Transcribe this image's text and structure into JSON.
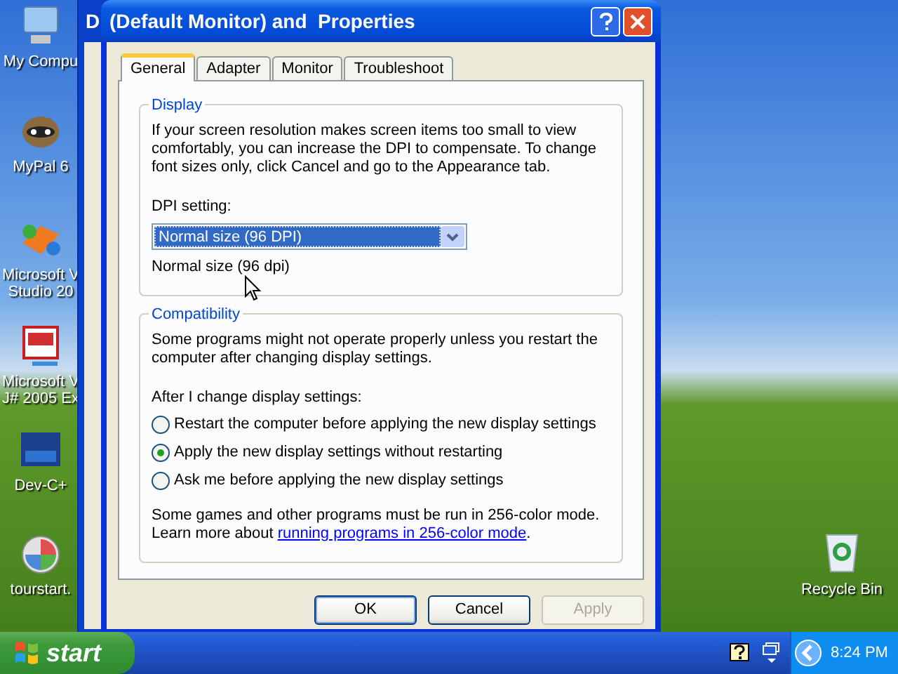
{
  "desktop_icons": [
    {
      "kind": "computer",
      "lines": [
        "My Compu"
      ]
    },
    {
      "kind": "raccoon",
      "lines": [
        "MyPal 6"
      ]
    },
    {
      "kind": "studio",
      "lines": [
        "Microsoft V",
        "Studio 20"
      ]
    },
    {
      "kind": "vj",
      "lines": [
        "Microsoft V",
        "J# 2005 Ex"
      ]
    },
    {
      "kind": "dev",
      "lines": [
        "Dev-C+"
      ]
    },
    {
      "kind": "tour",
      "lines": [
        "tourstart."
      ]
    }
  ],
  "recycle_bin": {
    "label": "Recycle Bin"
  },
  "back_window": {
    "title": "D"
  },
  "dialog": {
    "title": "(Default Monitor) and  Properties",
    "tabs": [
      {
        "label": "General",
        "selected": true
      },
      {
        "label": "Adapter",
        "selected": false
      },
      {
        "label": "Monitor",
        "selected": false
      },
      {
        "label": "Troubleshoot",
        "selected": false
      }
    ],
    "display": {
      "legend": "Display",
      "text": "If your screen resolution makes screen items too small to view comfortably, you can increase the DPI to compensate.  To change font sizes only, click Cancel and go to the Appearance tab.",
      "dpi_label": "DPI setting:",
      "dpi_value": "Normal size (96 DPI)",
      "dpi_caption": "Normal size (96 dpi)"
    },
    "compatibility": {
      "legend": "Compatibility",
      "text": "Some programs might not operate properly unless you restart the computer after changing display settings.",
      "prompt": "After I change display settings:",
      "options": [
        {
          "label": "Restart the computer before applying the new display settings",
          "selected": false
        },
        {
          "label": "Apply the new display settings without restarting",
          "selected": true
        },
        {
          "label": "Ask me before applying the new display settings",
          "selected": false
        }
      ],
      "note": "Some games and other programs must be run in 256-color mode.",
      "learn_prefix": "Learn more about",
      "link": "running programs in 256-color mode",
      "learn_suffix": "."
    },
    "buttons": [
      {
        "label": "OK",
        "disabled": false,
        "default": true
      },
      {
        "label": "Cancel",
        "disabled": false,
        "default": false
      },
      {
        "label": "Apply",
        "disabled": true,
        "default": false
      }
    ]
  },
  "taskbar": {
    "start": "start",
    "clock": "8:24 PM"
  }
}
